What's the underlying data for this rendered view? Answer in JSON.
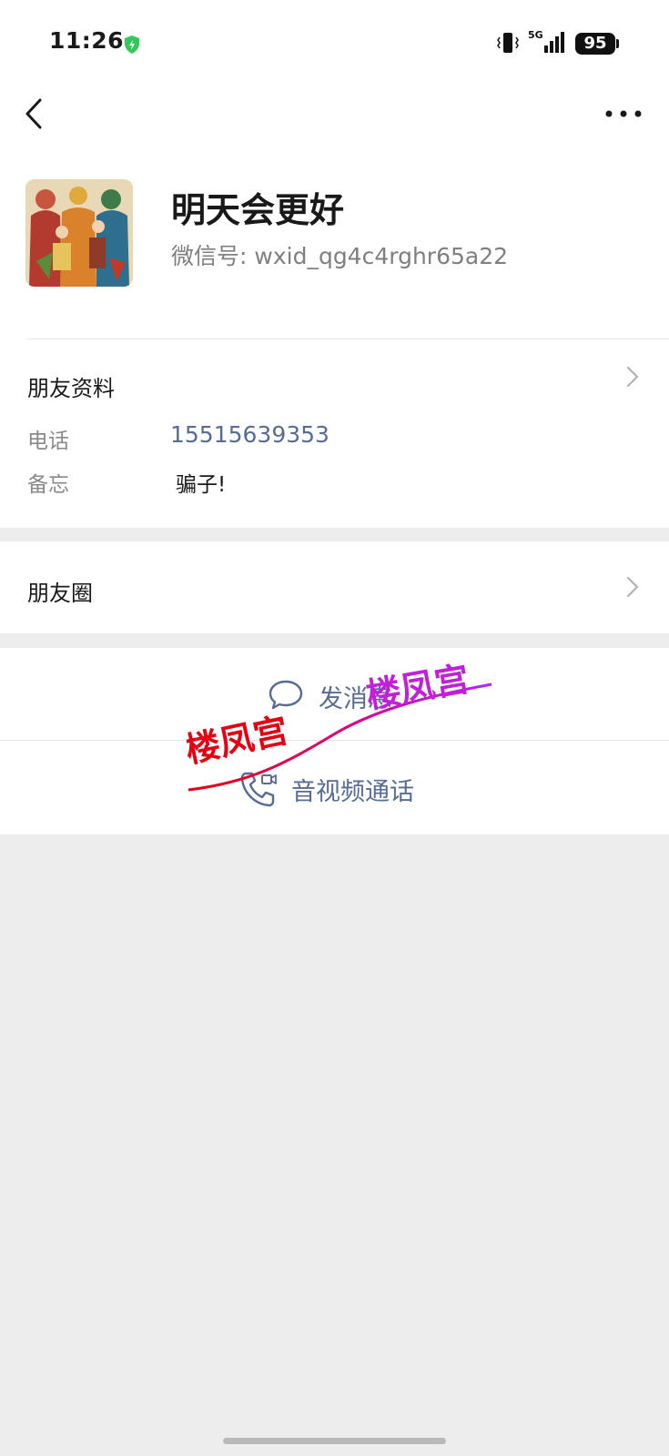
{
  "status_bar": {
    "time": "11:26",
    "network": "5G",
    "battery": "95",
    "icons": [
      "shield-icon",
      "vibrate-icon",
      "signal-icon",
      "battery-icon"
    ]
  },
  "nav": {
    "back_icon": "chevron-left-icon",
    "more_icon": "more-dots-icon"
  },
  "profile": {
    "nickname": "明天会更好",
    "wxid_label": "微信号:",
    "wxid": "wxid_qg4c4rghr65a22"
  },
  "friend_info": {
    "title": "朋友资料",
    "phone_label": "电话",
    "phone": "15515639353",
    "remark_label": "备忘",
    "remark": "骗子!"
  },
  "moments": {
    "title": "朋友圈"
  },
  "actions": {
    "message_label": "发消息",
    "call_label": "音视频通话"
  },
  "watermark": {
    "text": "楼凤宫"
  },
  "colors": {
    "link_blue": "#576b95",
    "background": "#ededed",
    "watermark_red": "#e60012",
    "watermark_purple": "#b026ff"
  }
}
